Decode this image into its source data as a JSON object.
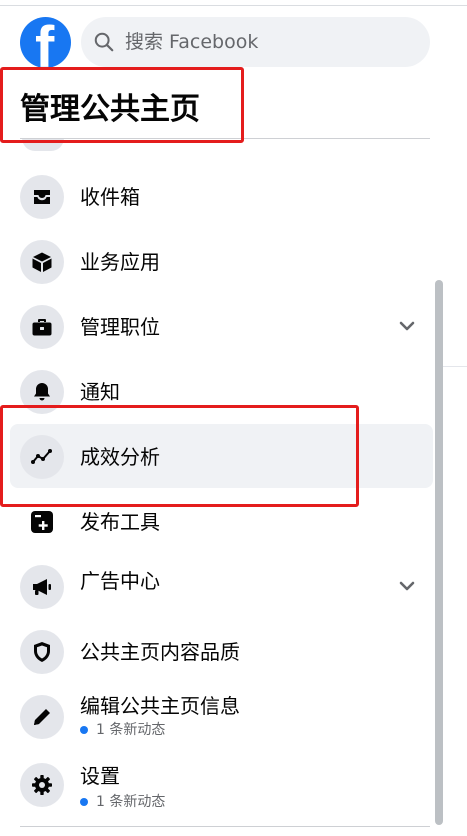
{
  "header": {
    "logo_letter": "f",
    "search_placeholder": "搜索 Facebook"
  },
  "sidebar": {
    "section_title": "管理公共主页",
    "items": [
      {
        "id": "inbox",
        "label": "收件箱",
        "icon": "inbox-icon",
        "has_chevron": false,
        "sub": ""
      },
      {
        "id": "business-apps",
        "label": "业务应用",
        "icon": "cube-icon",
        "has_chevron": false,
        "sub": ""
      },
      {
        "id": "manage-jobs",
        "label": "管理职位",
        "icon": "briefcase-icon",
        "has_chevron": true,
        "sub": ""
      },
      {
        "id": "notifications",
        "label": "通知",
        "icon": "bell-icon",
        "has_chevron": false,
        "sub": ""
      },
      {
        "id": "insights",
        "label": "成效分析",
        "icon": "chart-line-icon",
        "has_chevron": false,
        "sub": "",
        "active": true
      },
      {
        "id": "publishing-tools",
        "label": "发布工具",
        "icon": "publish-tools-icon",
        "has_chevron": false,
        "sub": ""
      },
      {
        "id": "ad-center",
        "label": "广告中心",
        "icon": "megaphone-icon",
        "has_chevron": true,
        "sub": ""
      },
      {
        "id": "page-quality",
        "label": "公共主页内容品质",
        "icon": "shield-icon",
        "has_chevron": false,
        "sub": ""
      },
      {
        "id": "edit-page-info",
        "label": "编辑公共主页信息",
        "icon": "pencil-icon",
        "has_chevron": false,
        "sub": "1 条新动态"
      },
      {
        "id": "settings",
        "label": "设置",
        "icon": "gear-icon",
        "has_chevron": false,
        "sub": "1 条新动态"
      }
    ]
  },
  "colors": {
    "brand": "#1877f2",
    "highlight_box": "#e41c1c",
    "active_bg": "#f0f2f5",
    "icon_bg": "#e4e6eb"
  }
}
